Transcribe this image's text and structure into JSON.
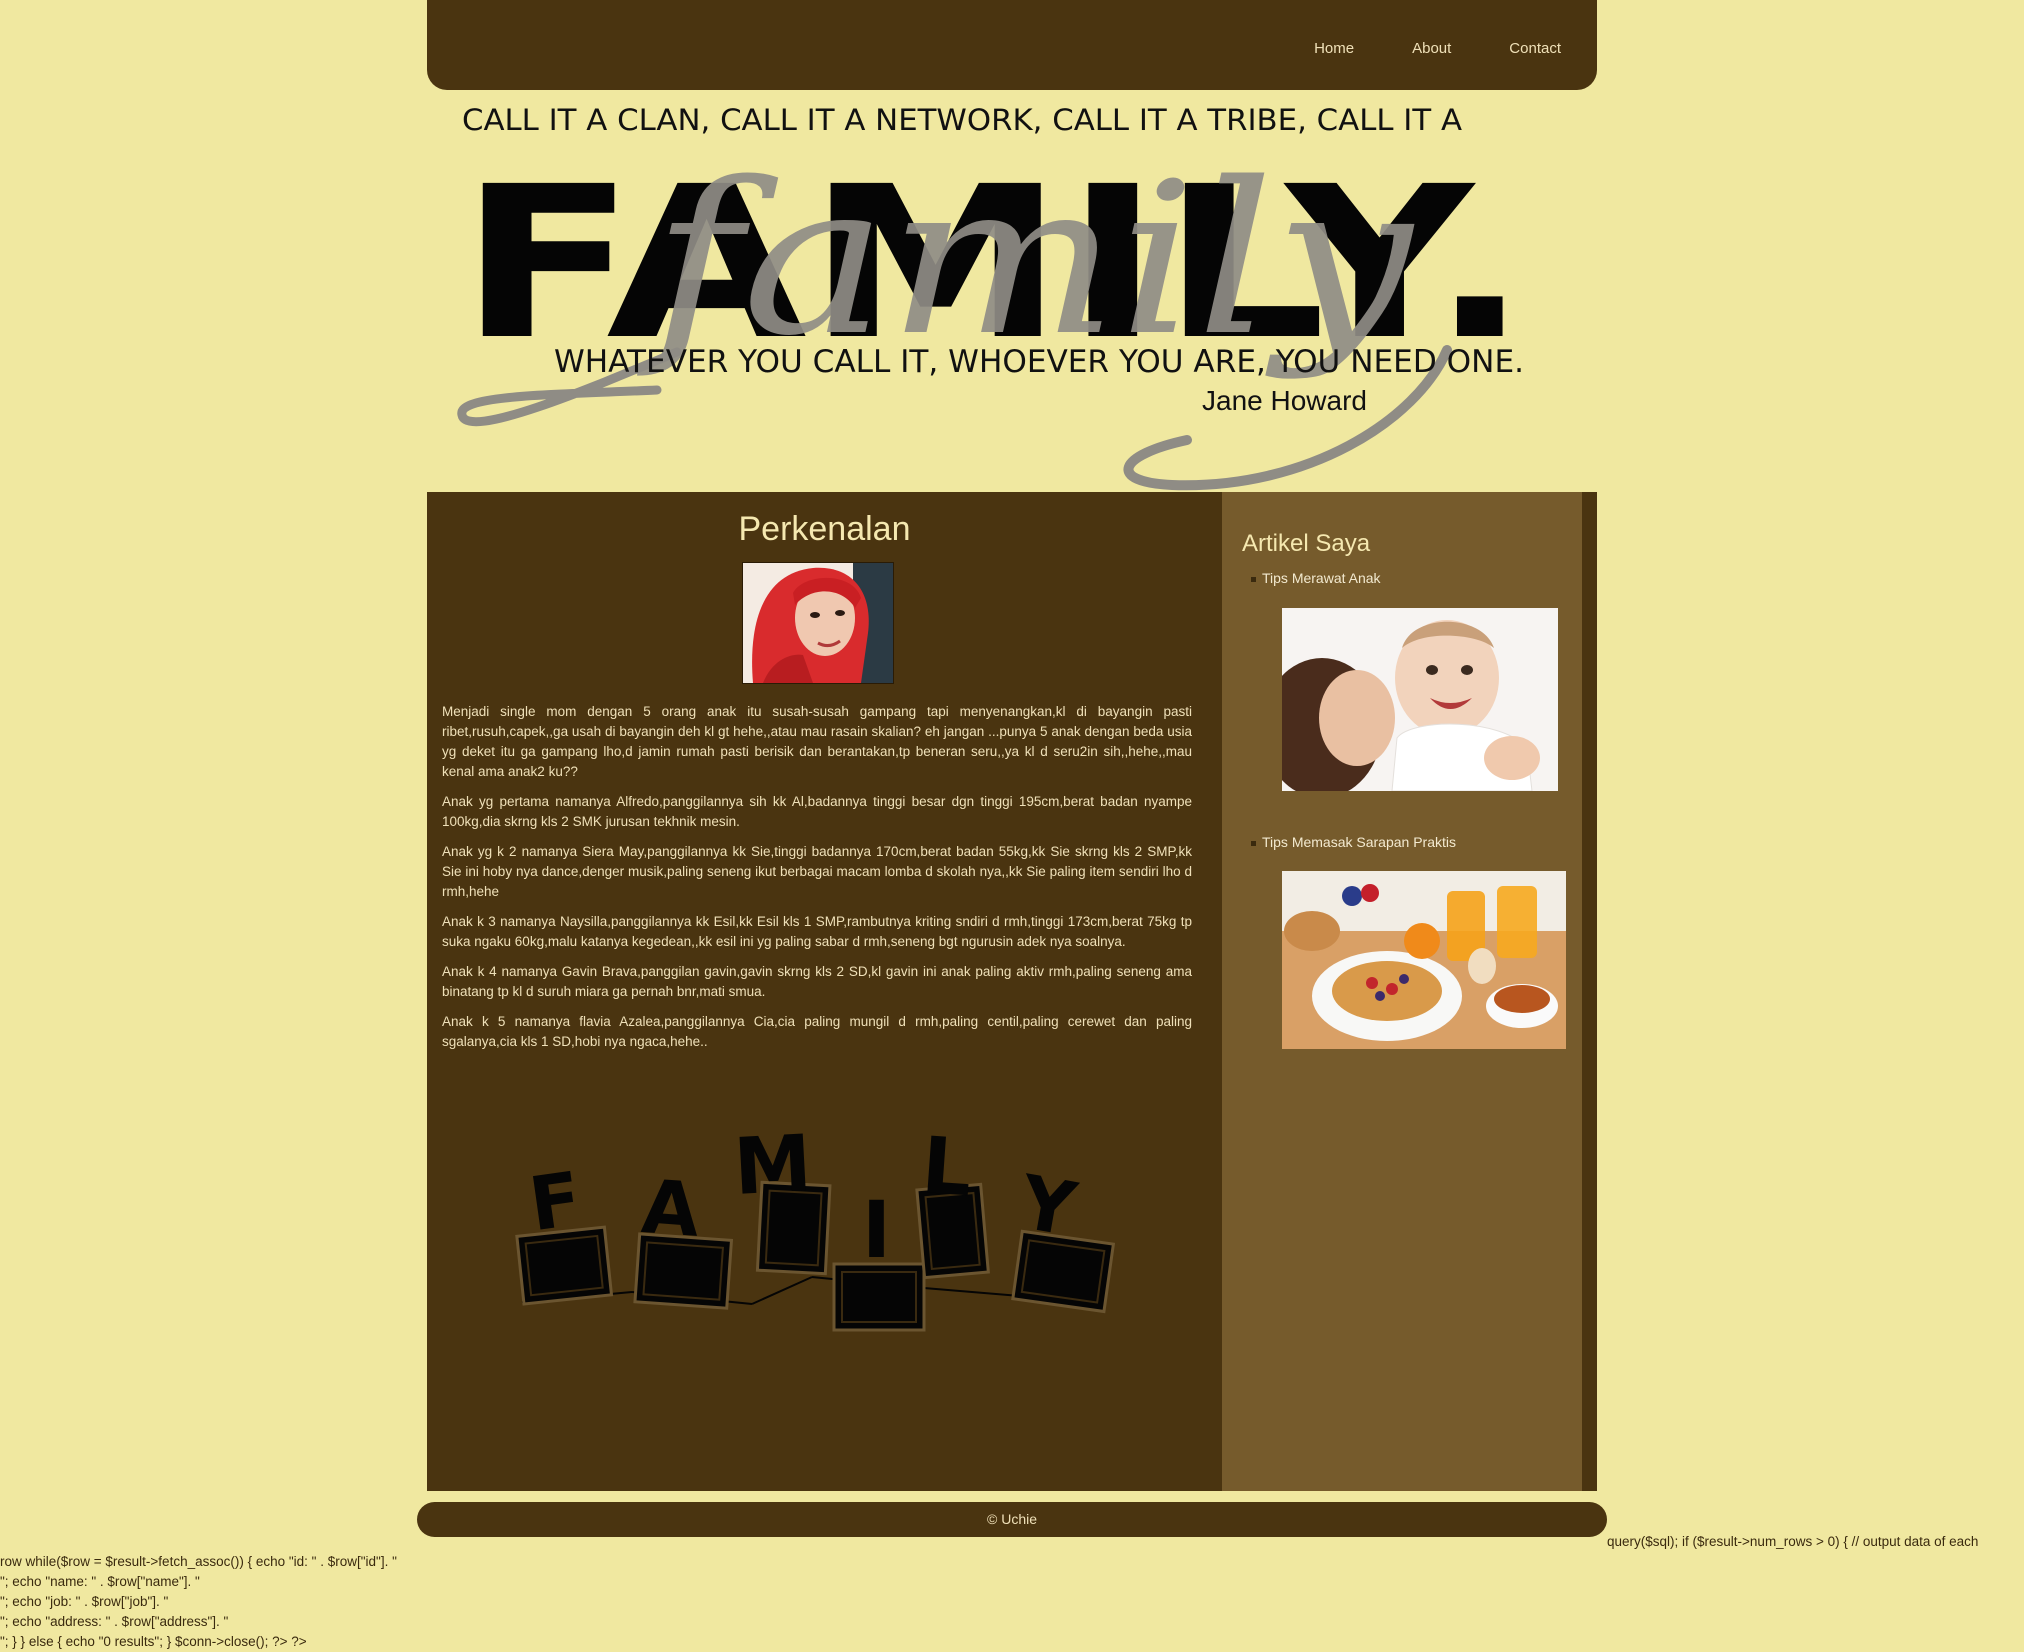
{
  "nav": {
    "items": [
      "Home",
      "About",
      "Contact"
    ]
  },
  "header": {
    "line1": "CALL IT A CLAN, CALL IT A NETWORK, CALL IT A TRIBE, CALL IT A",
    "big_word": "FAMILY.",
    "script_word": "family",
    "line2": "WHATEVER YOU CALL IT, WHOEVER YOU ARE, YOU NEED ONE.",
    "author": "Jane Howard"
  },
  "main": {
    "title": "Perkenalan",
    "paragraphs": [
      "Menjadi single mom dengan 5 orang anak itu susah-susah gampang tapi menyenangkan,kl di bayangin pasti ribet,rusuh,capek,,ga usah di bayangin deh kl gt hehe,,atau mau rasain skalian? eh jangan ...punya 5 anak dengan beda usia yg deket itu ga gampang lho,d jamin rumah pasti berisik dan berantakan,tp beneran seru,,ya kl d seru2in sih,,hehe,,mau kenal ama anak2 ku??",
      "Anak yg pertama namanya Alfredo,panggilannya sih kk Al,badannya tinggi besar dgn tinggi 195cm,berat badan nyampe 100kg,dia skrng kls 2 SMK jurusan tekhnik mesin.",
      "Anak yg k 2 namanya Siera May,panggilannya kk Sie,tinggi badannya 170cm,berat badan 55kg,kk Sie skrng kls 2 SMP,kk Sie ini hoby nya dance,denger musik,paling seneng ikut berbagai macam lomba d skolah nya,,kk Sie paling item sendiri lho d rmh,hehe",
      "Anak k 3 namanya Naysilla,panggilannya kk Esil,kk Esil kls 1 SMP,rambutnya kriting sndiri d rmh,tinggi 173cm,berat 75kg tp suka ngaku 60kg,malu katanya kegedean,,kk esil ini yg paling sabar d rmh,seneng bgt ngurusin adek nya soalnya.",
      "Anak k 4 namanya Gavin Brava,panggilan gavin,gavin skrng kls 2 SD,kl gavin ini anak paling aktiv rmh,paling seneng ama binatang tp kl d suruh miara ga pernah bnr,mati smua.",
      "Anak k 5 namanya flavia Azalea,panggilannya Cia,cia paling mungil d rmh,paling centil,paling cerewet dan paling sgalanya,cia kls 1 SD,hobi nya ngaca,hehe.."
    ],
    "deco_letters": [
      "F",
      "A",
      "M",
      "I",
      "L",
      "Y"
    ]
  },
  "sidebar": {
    "title": "Artikel Saya",
    "items": [
      "Tips Merawat Anak",
      "Tips Memasak Sarapan Praktis"
    ]
  },
  "footer": {
    "text": "© Uchie"
  },
  "code_lines": [
    "query($sql); if ($result->num_rows > 0) { // output data of each",
    "row while($row = $result->fetch_assoc()) { echo \"id: \" . $row[\"id\"]. \"",
    "\"; echo \"name: \" . $row[\"name\"]. \"",
    "\"; echo \"job: \" . $row[\"job\"]. \"",
    "\"; echo \"address: \" . $row[\"address\"]. \"",
    "\"; } } else { echo \"0 results\"; } $conn->close(); ?> ?>"
  ],
  "colors": {
    "background": "#f0e8a0",
    "dark_brown": "#4a3410",
    "sidebar_brown": "#765b2c",
    "light_text": "#efe0b8"
  }
}
